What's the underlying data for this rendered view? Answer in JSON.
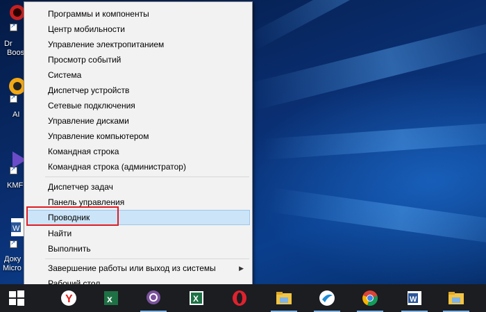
{
  "menu": {
    "items_group1": [
      {
        "label": "Программы и компоненты"
      },
      {
        "label": "Центр мобильности"
      },
      {
        "label": "Управление электропитанием"
      },
      {
        "label": "Просмотр событий"
      },
      {
        "label": "Система"
      },
      {
        "label": "Диспетчер устройств"
      },
      {
        "label": "Сетевые подключения"
      },
      {
        "label": "Управление дисками"
      },
      {
        "label": "Управление компьютером"
      },
      {
        "label": "Командная строка"
      },
      {
        "label": "Командная строка (администратор)"
      }
    ],
    "items_group2": [
      {
        "label": "Диспетчер задач"
      },
      {
        "label": "Панель управления"
      },
      {
        "label": "Проводник"
      },
      {
        "label": "Найти"
      },
      {
        "label": "Выполнить"
      }
    ],
    "items_group3": [
      {
        "label": "Завершение работы или выход из системы",
        "submenu_icon": "chevron-right-icon"
      },
      {
        "label": "Рабочий стол"
      }
    ],
    "highlighted": "Проводник"
  },
  "desktop_icons": [
    {
      "caption_line1": "Dr",
      "caption_line2": "Boos",
      "icon": "driver-booster-icon"
    },
    {
      "caption_line1": "AI",
      "icon": "aimp-icon"
    },
    {
      "caption_line1": "KMF",
      "icon": "kmplayer-icon"
    },
    {
      "caption_line1": "Доку",
      "caption_line2": "Micro",
      "icon": "word-document-icon"
    }
  ],
  "taskbar": {
    "icons": [
      "start-windows-icon",
      "yandex-browser-icon",
      "excel-icon",
      "viber-icon",
      "excel-icon",
      "opera-icon",
      "file-explorer-icon",
      "skype-icon",
      "chrome-icon",
      "word-icon",
      "file-explorer-icon"
    ]
  },
  "colors": {
    "highlight_bg": "#cce4f7",
    "annotation_red": "#e01b24",
    "taskbar": "#1b1d21"
  }
}
